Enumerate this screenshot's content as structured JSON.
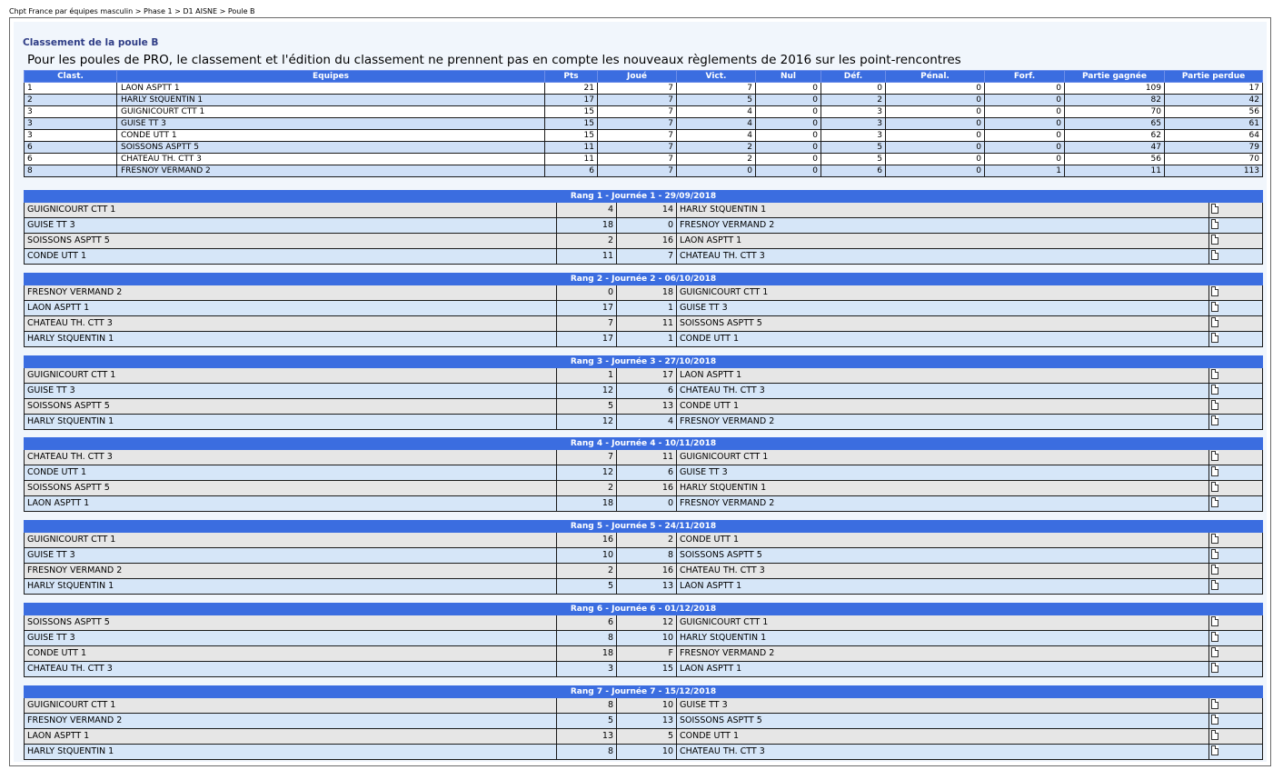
{
  "breadcrumb": "Chpt France par équipes masculin > Phase 1 > D1 AISNE > Poule B",
  "section_title": "Classement de la poule B",
  "notice": "Pour les poules de PRO, le classement et l'édition du classement ne prennent pas en compte les nouveaux règlements de 2016 sur les point-rencontres",
  "standings": {
    "headers": [
      "Clast.",
      "Equipes",
      "Pts",
      "Joué",
      "Vict.",
      "Nul",
      "Déf.",
      "Pénal.",
      "Forf.",
      "Partie gagnée",
      "Partie perdue"
    ],
    "rows": [
      [
        "1",
        "LAON ASPTT 1",
        "21",
        "7",
        "7",
        "0",
        "0",
        "0",
        "0",
        "109",
        "17"
      ],
      [
        "2",
        "HARLY StQUENTIN 1",
        "17",
        "7",
        "5",
        "0",
        "2",
        "0",
        "0",
        "82",
        "42"
      ],
      [
        "3",
        "GUIGNICOURT CTT 1",
        "15",
        "7",
        "4",
        "0",
        "3",
        "0",
        "0",
        "70",
        "56"
      ],
      [
        "3",
        "GUISE TT 3",
        "15",
        "7",
        "4",
        "0",
        "3",
        "0",
        "0",
        "65",
        "61"
      ],
      [
        "3",
        "CONDE UTT 1",
        "15",
        "7",
        "4",
        "0",
        "3",
        "0",
        "0",
        "62",
        "64"
      ],
      [
        "6",
        "SOISSONS ASPTT 5",
        "11",
        "7",
        "2",
        "0",
        "5",
        "0",
        "0",
        "47",
        "79"
      ],
      [
        "6",
        "CHATEAU TH. CTT 3",
        "11",
        "7",
        "2",
        "0",
        "5",
        "0",
        "0",
        "56",
        "70"
      ],
      [
        "8",
        "FRESNOY VERMAND 2",
        "6",
        "7",
        "0",
        "0",
        "6",
        "0",
        "1",
        "11",
        "113"
      ]
    ]
  },
  "rounds": [
    {
      "title": "Rang 1 - Journée 1 - 29/09/2018",
      "matches": [
        [
          "GUIGNICOURT CTT 1",
          "4",
          "14",
          "HARLY StQUENTIN 1"
        ],
        [
          "GUISE TT 3",
          "18",
          "0",
          "FRESNOY VERMAND 2"
        ],
        [
          "SOISSONS ASPTT 5",
          "2",
          "16",
          "LAON ASPTT 1"
        ],
        [
          "CONDE UTT 1",
          "11",
          "7",
          "CHATEAU TH. CTT 3"
        ]
      ]
    },
    {
      "title": "Rang 2 - Journée 2 - 06/10/2018",
      "matches": [
        [
          "FRESNOY VERMAND 2",
          "0",
          "18",
          "GUIGNICOURT CTT 1"
        ],
        [
          "LAON ASPTT 1",
          "17",
          "1",
          "GUISE TT 3"
        ],
        [
          "CHATEAU TH. CTT 3",
          "7",
          "11",
          "SOISSONS ASPTT 5"
        ],
        [
          "HARLY StQUENTIN 1",
          "17",
          "1",
          "CONDE UTT 1"
        ]
      ]
    },
    {
      "title": "Rang 3 - Journée 3 - 27/10/2018",
      "matches": [
        [
          "GUIGNICOURT CTT 1",
          "1",
          "17",
          "LAON ASPTT 1"
        ],
        [
          "GUISE TT 3",
          "12",
          "6",
          "CHATEAU TH. CTT 3"
        ],
        [
          "SOISSONS ASPTT 5",
          "5",
          "13",
          "CONDE UTT 1"
        ],
        [
          "HARLY StQUENTIN 1",
          "12",
          "4",
          "FRESNOY VERMAND 2"
        ]
      ]
    },
    {
      "title": "Rang 4 - Journée 4 - 10/11/2018",
      "matches": [
        [
          "CHATEAU TH. CTT 3",
          "7",
          "11",
          "GUIGNICOURT CTT 1"
        ],
        [
          "CONDE UTT 1",
          "12",
          "6",
          "GUISE TT 3"
        ],
        [
          "SOISSONS ASPTT 5",
          "2",
          "16",
          "HARLY StQUENTIN 1"
        ],
        [
          "LAON ASPTT 1",
          "18",
          "0",
          "FRESNOY VERMAND 2"
        ]
      ]
    },
    {
      "title": "Rang 5 - Journée 5 - 24/11/2018",
      "matches": [
        [
          "GUIGNICOURT CTT 1",
          "16",
          "2",
          "CONDE UTT 1"
        ],
        [
          "GUISE TT 3",
          "10",
          "8",
          "SOISSONS ASPTT 5"
        ],
        [
          "FRESNOY VERMAND 2",
          "2",
          "16",
          "CHATEAU TH. CTT 3"
        ],
        [
          "HARLY StQUENTIN 1",
          "5",
          "13",
          "LAON ASPTT 1"
        ]
      ]
    },
    {
      "title": "Rang 6 - Journée 6 - 01/12/2018",
      "matches": [
        [
          "SOISSONS ASPTT 5",
          "6",
          "12",
          "GUIGNICOURT CTT 1"
        ],
        [
          "GUISE TT 3",
          "8",
          "10",
          "HARLY StQUENTIN 1"
        ],
        [
          "CONDE UTT 1",
          "18",
          "F",
          "FRESNOY VERMAND 2"
        ],
        [
          "CHATEAU TH. CTT 3",
          "3",
          "15",
          "LAON ASPTT 1"
        ]
      ]
    },
    {
      "title": "Rang 7 - Journée 7 - 15/12/2018",
      "matches": [
        [
          "GUIGNICOURT CTT 1",
          "8",
          "10",
          "GUISE TT 3"
        ],
        [
          "FRESNOY VERMAND 2",
          "5",
          "13",
          "SOISSONS ASPTT 5"
        ],
        [
          "LAON ASPTT 1",
          "13",
          "5",
          "CONDE UTT 1"
        ],
        [
          "HARLY StQUENTIN 1",
          "8",
          "10",
          "CHATEAU TH. CTT 3"
        ]
      ]
    }
  ],
  "icons": {
    "match_sheet": "document-icon"
  },
  "colors": {
    "header_blue": "#3b6de0",
    "title_blue": "#2f3d86",
    "row_light_blue": "#cfe0f7",
    "row_grey": "#e6e6e6"
  }
}
